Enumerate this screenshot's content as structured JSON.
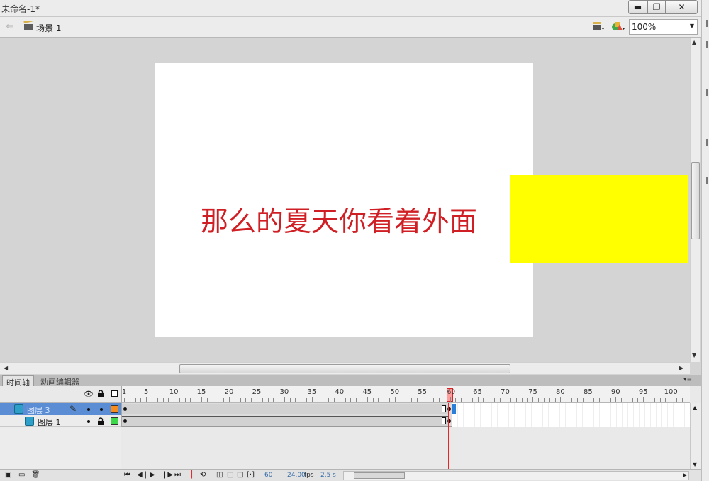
{
  "window": {
    "title": "未命名-1*",
    "minimize_glyph": "▬",
    "maximize_glyph": "❐",
    "close_glyph": "✕"
  },
  "editbar": {
    "scene_label": "场景 1",
    "zoom": "100%"
  },
  "stage": {
    "text": "那么的夏天你看着外面",
    "text_color": "#d01f24",
    "background": "#ffffff",
    "yellow_rect_color": "#ffff00"
  },
  "panel_tabs": {
    "timeline": "时间轴",
    "motion_editor": "动画编辑器"
  },
  "timeline": {
    "frame_numbers": [
      "1",
      "5",
      "10",
      "15",
      "20",
      "25",
      "30",
      "35",
      "40",
      "45",
      "50",
      "55",
      "60",
      "65",
      "70",
      "75",
      "80",
      "85",
      "90",
      "95",
      "100"
    ],
    "current_frame": "60",
    "layers": [
      {
        "name": "图层 3",
        "color": "#f68b1e",
        "selected": true,
        "locked": false
      },
      {
        "name": "图层 1",
        "color": "#3cd84a",
        "selected": false,
        "locked": true
      }
    ],
    "status": {
      "frame": "60",
      "fps": "24.00",
      "fps_unit": "fps",
      "time": "2.5 s"
    }
  },
  "icons": {
    "back": "back-arrow-icon",
    "scene": "scene-clapper-icon",
    "edit_scene": "edit-scene-icon",
    "edit_symbol": "edit-symbol-icon",
    "eye": "eye-icon",
    "lock": "lock-icon",
    "outline": "outline-icon",
    "pencil": "pencil-icon"
  }
}
